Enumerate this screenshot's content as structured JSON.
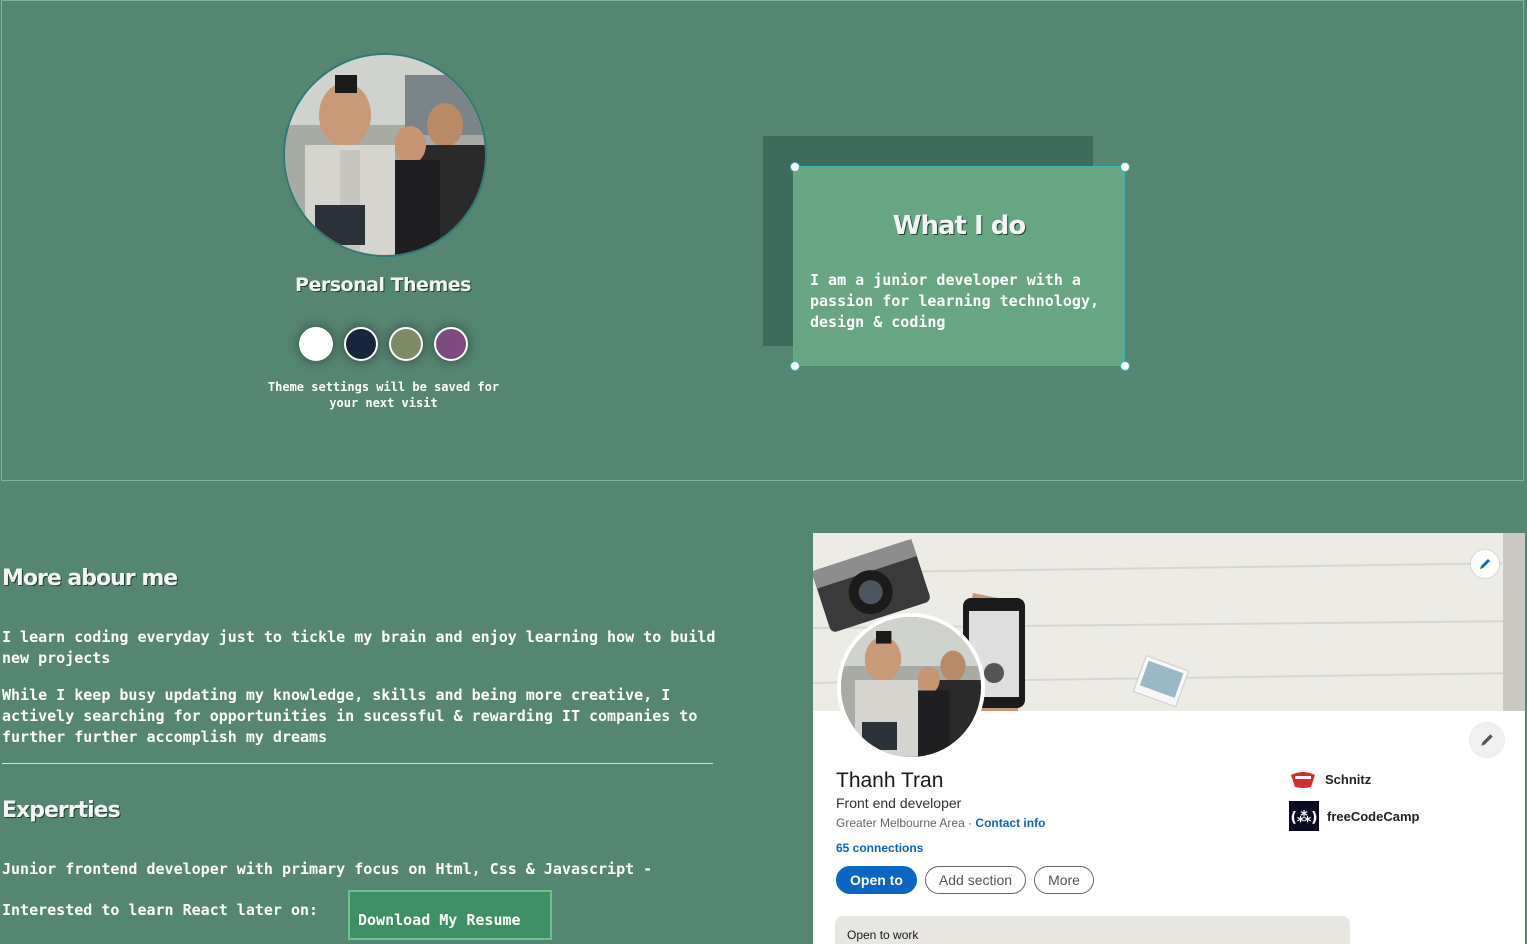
{
  "themes": {
    "title": "Personal Themes",
    "swatches": [
      {
        "name": "light",
        "color": "#ffffff"
      },
      {
        "name": "dark",
        "color": "#17263a"
      },
      {
        "name": "olive",
        "color": "#7d8a66"
      },
      {
        "name": "purple",
        "color": "#7d4a80"
      }
    ],
    "note": "Theme settings will be saved for your next visit"
  },
  "what_i_do": {
    "title": "What I do",
    "text": "I am a junior developer with a passion for learning technology, design & coding"
  },
  "about": {
    "heading": "More abour me",
    "para1": "I learn coding everyday just to tickle my brain and enjoy learning how to build new projects",
    "para2": "While I keep busy updating my knowledge, skills and being more creative, I actively searching for opportunities in sucessful & rewarding IT companies to further further accomplish my dreams"
  },
  "expertise": {
    "heading": "Experrties",
    "text": "Junior frontend developer with primary focus on Html, Css & Javascript -",
    "interested": "Interested to learn React later on:",
    "download_label": "Download My Resume"
  },
  "linkedin": {
    "name": "Thanh Tran",
    "headline": "Front end developer",
    "location": "Greater Melbourne Area",
    "separator": " · ",
    "contact": "Contact info",
    "connections": "65 connections",
    "buttons": {
      "open_to": "Open to",
      "add_section": "Add section",
      "more": "More"
    },
    "companies": [
      {
        "name": "Schnitz",
        "icon": "schnitz-logo"
      },
      {
        "name": "freeCodeCamp",
        "icon": "freecodecamp-logo"
      }
    ],
    "open_to_work": "Open to work",
    "accent": "#0a66c2"
  }
}
